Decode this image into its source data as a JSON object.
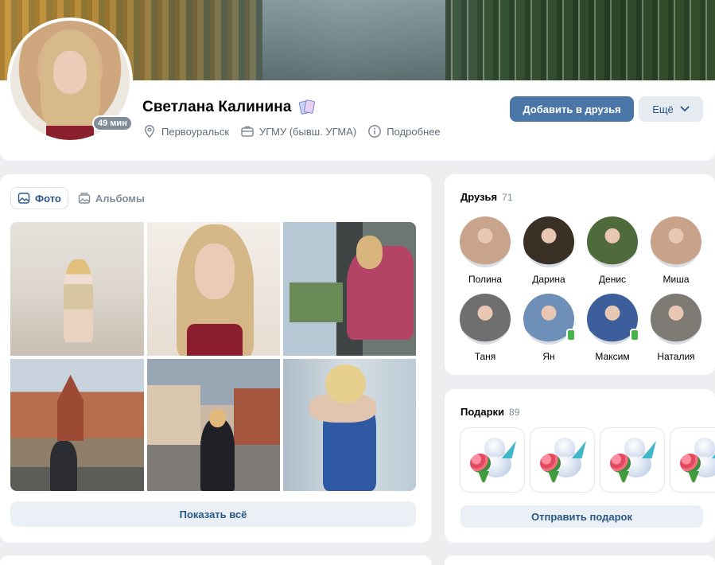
{
  "profile": {
    "name": "Светлана Калинина",
    "online_badge": "49 мин",
    "city": "Первоуральск",
    "education": "УГМУ (бывш. УГМА)",
    "details": "Подробнее"
  },
  "actions": {
    "add_friend": "Добавить в друзья",
    "more": "Ещё"
  },
  "photos": {
    "tabs": [
      {
        "label": "Фото",
        "icon": "photo-icon",
        "active": true
      },
      {
        "label": "Альбомы",
        "icon": "albums-icon",
        "active": false
      }
    ],
    "show_all": "Показать всё"
  },
  "friends": {
    "title": "Друзья",
    "count": "71",
    "items": [
      {
        "name": "Полина",
        "mobile": false,
        "color": "#c9a48c"
      },
      {
        "name": "Дарина",
        "mobile": false,
        "color": "#3a3026"
      },
      {
        "name": "Денис",
        "mobile": false,
        "color": "#4f6b3b"
      },
      {
        "name": "Миша",
        "mobile": false,
        "color": "#c9a28a"
      },
      {
        "name": "Таня",
        "mobile": false,
        "color": "#6f6f6f"
      },
      {
        "name": "Ян",
        "mobile": true,
        "color": "#6d8fb8"
      },
      {
        "name": "Максим",
        "mobile": true,
        "color": "#3c5f9c"
      },
      {
        "name": "Наталия",
        "mobile": false,
        "color": "#7e7a74"
      }
    ]
  },
  "gifts": {
    "title": "Подарки",
    "count": "89",
    "send_gift": "Отправить подарок"
  },
  "colors": {
    "accent": "#4a76a8",
    "link": "#2a5885",
    "online_mobile": "#4bb34b"
  }
}
